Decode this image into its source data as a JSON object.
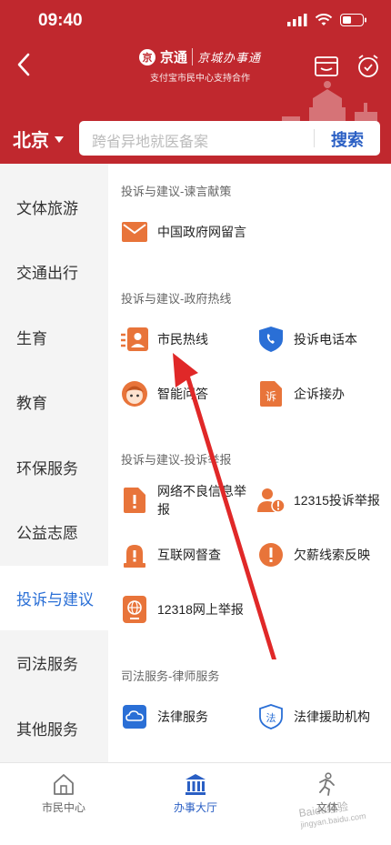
{
  "status": {
    "time": "09:40"
  },
  "nav": {
    "logo_text": "京通",
    "logo_seal": "京",
    "logo_script": "京城办事通",
    "subtitle": "支付宝市民中心支持合作"
  },
  "search": {
    "city": "北京",
    "placeholder": "跨省异地就医备案",
    "button": "搜索"
  },
  "sidebar": {
    "items": [
      {
        "label": "文体旅游"
      },
      {
        "label": "交通出行"
      },
      {
        "label": "生育"
      },
      {
        "label": "教育"
      },
      {
        "label": "环保服务"
      },
      {
        "label": "公益志愿"
      },
      {
        "label": "投诉与建议",
        "active": true
      },
      {
        "label": "司法服务"
      },
      {
        "label": "其他服务"
      }
    ]
  },
  "sections": [
    {
      "title": "投诉与建议-谏言献策",
      "items": [
        {
          "label": "中国政府网留言",
          "icon": "envelope-icon"
        }
      ]
    },
    {
      "title": "投诉与建议-政府热线",
      "items": [
        {
          "label": "市民热线",
          "icon": "hotline-card-icon"
        },
        {
          "label": "投诉电话本",
          "icon": "shield-phone-icon"
        },
        {
          "label": "智能问答",
          "icon": "assistant-icon"
        },
        {
          "label": "企诉接办",
          "icon": "complaint-doc-icon"
        }
      ]
    },
    {
      "title": "投诉与建议-投诉举报",
      "items": [
        {
          "label": "网络不良信息举报",
          "icon": "alert-doc-icon"
        },
        {
          "label": "12315投诉举报",
          "icon": "person-alert-icon"
        },
        {
          "label": "互联网督查",
          "icon": "siren-icon"
        },
        {
          "label": "欠薪线索反映",
          "icon": "exclamation-circle-icon"
        },
        {
          "label": "12318网上举报",
          "icon": "globe-tablet-icon"
        }
      ]
    },
    {
      "title": "司法服务-律师服务",
      "items": [
        {
          "label": "法律服务",
          "icon": "law-cloud-icon"
        },
        {
          "label": "法律援助机构",
          "icon": "law-shield-icon"
        }
      ]
    }
  ],
  "tabbar": [
    {
      "label": "市民中心",
      "icon": "home-icon"
    },
    {
      "label": "办事大厅",
      "icon": "hall-icon",
      "active": true
    },
    {
      "label": "文体",
      "icon": "runner-icon"
    }
  ],
  "watermark": {
    "text": "Baidu经验",
    "sub": "jingyan.baidu.com"
  },
  "colors": {
    "brand_red": "#c0282e",
    "accent_blue": "#2a5fc4",
    "icon_orange": "#e8743a",
    "annotation_red": "#e02828"
  }
}
